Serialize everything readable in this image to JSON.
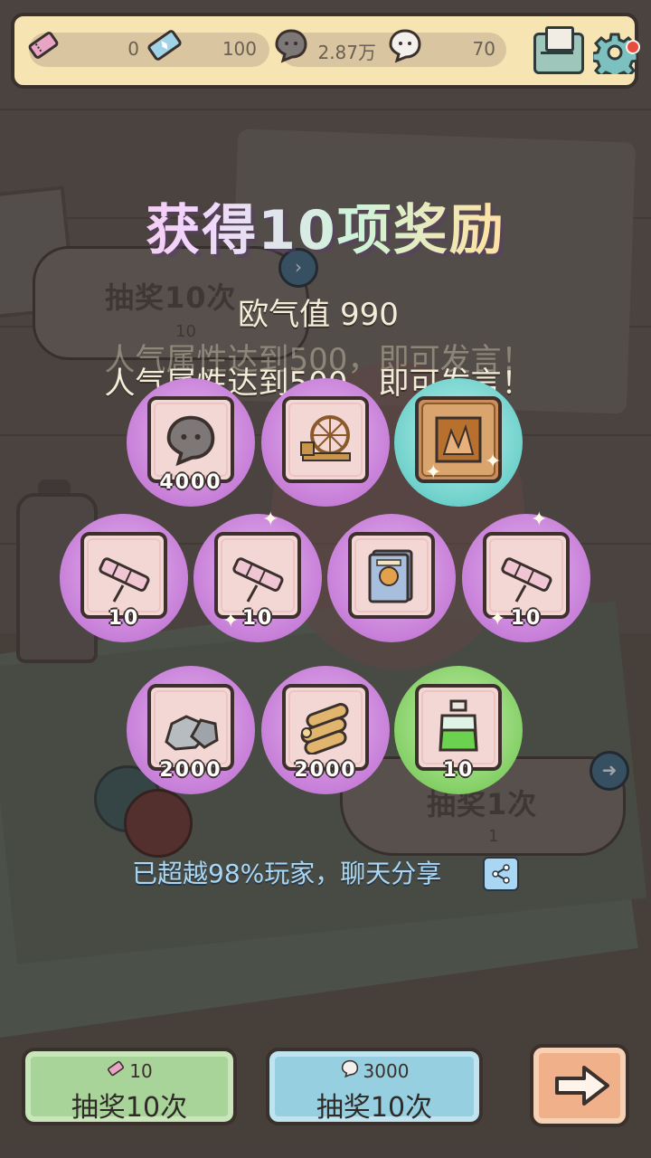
{
  "resources": [
    {
      "icon": "ticket-icon",
      "value": "0"
    },
    {
      "icon": "blue-ticket-icon",
      "value": "100"
    },
    {
      "icon": "dark-bubble-icon",
      "value": "2.87万"
    },
    {
      "icon": "white-bubble-icon",
      "value": "70"
    }
  ],
  "background": {
    "draw10_label": "抽奖10次",
    "draw10_cost": "10",
    "draw1_label": "抽奖1次",
    "draw1_cost": "1"
  },
  "reward": {
    "title": "获得10项奖励",
    "luck_label": "欧气值 990",
    "hint": "人气属性达到500，即可发言！",
    "items": [
      {
        "icon": "dark-bubble-icon",
        "qty": "4000",
        "rarity": "purple"
      },
      {
        "icon": "spinning-wheel-icon",
        "qty": "",
        "rarity": "purple"
      },
      {
        "icon": "framed-painting-icon",
        "qty": "",
        "rarity": "cyan"
      },
      {
        "icon": "telescope-icon",
        "qty": "10",
        "rarity": "purple"
      },
      {
        "icon": "telescope-icon",
        "qty": "10",
        "rarity": "purple"
      },
      {
        "icon": "spellbook-icon",
        "qty": "",
        "rarity": "purple"
      },
      {
        "icon": "telescope-icon",
        "qty": "10",
        "rarity": "purple"
      },
      {
        "icon": "stone-icon",
        "qty": "2000",
        "rarity": "purple"
      },
      {
        "icon": "wood-logs-icon",
        "qty": "2000",
        "rarity": "purple"
      },
      {
        "icon": "green-potion-icon",
        "qty": "10",
        "rarity": "green"
      }
    ],
    "beyond_text": "已超越98%玩家，聊天分享"
  },
  "buttons": {
    "ticket_draw": {
      "cost": "10",
      "label": "抽奖10次"
    },
    "bubble_draw": {
      "cost": "3000",
      "label": "抽奖10次"
    }
  },
  "colors": {
    "purple": "#c77fd8",
    "cyan": "#6fd1cb",
    "green": "#85d067",
    "topbar": "#f6e4b3"
  }
}
